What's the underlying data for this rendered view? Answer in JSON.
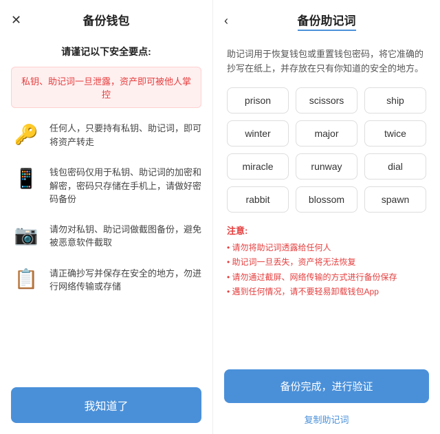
{
  "left": {
    "close_icon": "✕",
    "title": "备份钱包",
    "subtitle": "请谨记以下安全要点:",
    "warning": "私钥、助记词一旦泄露，资产即可被他人掌控",
    "tips": [
      {
        "icon": "🔑",
        "text": "任何人，只要持有私钥、助记词，即可将资产转走"
      },
      {
        "icon": "📱",
        "text": "钱包密码仅用于私钥、助记词的加密和解密，密码只存储在手机上，请做好密码备份"
      },
      {
        "icon": "📷",
        "text": "请勿对私钥、助记词做截图备份，避免被恶意软件截取"
      },
      {
        "icon": "📋",
        "text": "请正确抄写并保存在安全的地方，勿进行网络传输或存储"
      }
    ],
    "know_btn": "我知道了"
  },
  "right": {
    "back_icon": "‹",
    "title": "备份助记词",
    "description": "助记词用于恢复钱包或重置钱包密码，将它准确的抄写在纸上，并存放在只有你知道的安全的地方。",
    "words": [
      "prison",
      "scissors",
      "ship",
      "winter",
      "major",
      "twice",
      "miracle",
      "runway",
      "dial",
      "rabbit",
      "blossom",
      "spawn"
    ],
    "notes_title": "注意:",
    "notes": [
      "请勿将助记词透露给任何人",
      "助记词一旦丢失，资产将无法恢复",
      "请勿通过截屏、网络传输的方式进行备份保存",
      "遇到任何情况，请不要轻易卸载钱包App"
    ],
    "backup_btn": "备份完成，进行验证",
    "copy_link": "复制助记词"
  }
}
